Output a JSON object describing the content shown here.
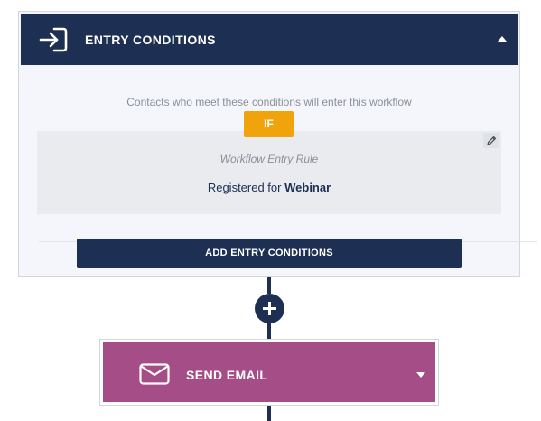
{
  "entry": {
    "title": "ENTRY CONDITIONS",
    "description": "Contacts who meet these conditions will enter this workflow",
    "if_label": "IF",
    "rule": {
      "title": "Workflow Entry Rule",
      "prefix": "Registered for",
      "value": "Webinar"
    },
    "add_button": "ADD ENTRY CONDITIONS",
    "icon": "sign-in-icon"
  },
  "action": {
    "title": "SEND EMAIL",
    "icon": "envelope-icon"
  },
  "colors": {
    "navy": "#1d2f52",
    "orange": "#f0a30a",
    "magenta": "#a54d86"
  }
}
